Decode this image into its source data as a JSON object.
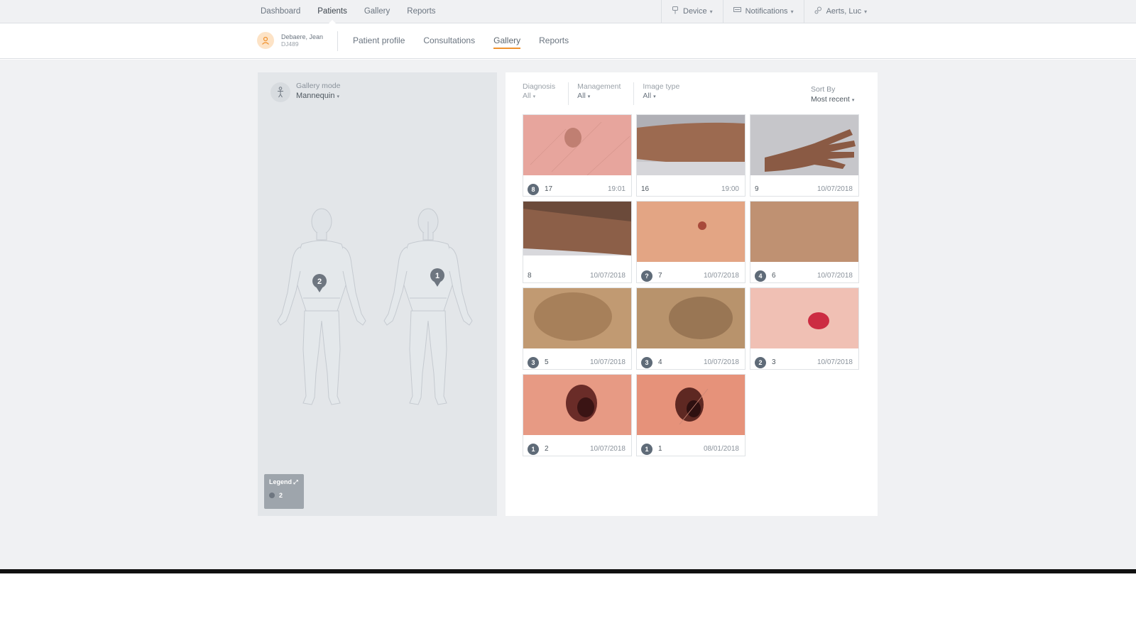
{
  "topnav": {
    "items": [
      {
        "label": "Dashboard",
        "active": false
      },
      {
        "label": "Patients",
        "active": true
      },
      {
        "label": "Gallery",
        "active": false
      },
      {
        "label": "Reports",
        "active": false
      }
    ],
    "device": {
      "label": "Device",
      "icon": "device-icon"
    },
    "notifications": {
      "label": "Notifications",
      "icon": "notifications-icon"
    },
    "user": {
      "label": "Aerts, Luc",
      "icon": "user-icon"
    }
  },
  "patient": {
    "name": "Debaere, Jean",
    "id": "DJ489",
    "icon": "patient-avatar-icon"
  },
  "subnav": {
    "tabs": [
      {
        "label": "Patient profile",
        "active": false
      },
      {
        "label": "Consultations",
        "active": false
      },
      {
        "label": "Gallery",
        "active": true
      },
      {
        "label": "Reports",
        "active": false
      }
    ]
  },
  "gallery_mode": {
    "label": "Gallery mode",
    "value": "Mannequin"
  },
  "mannequin": {
    "markers": [
      {
        "label": "2",
        "view": "front"
      },
      {
        "label": "1",
        "view": "back"
      }
    ]
  },
  "legend": {
    "title": "Legend",
    "count": "2"
  },
  "filters": {
    "diagnosis": {
      "label": "Diagnosis",
      "value": "All"
    },
    "management": {
      "label": "Management",
      "value": "All"
    },
    "image_type": {
      "label": "Image type",
      "value": "All"
    }
  },
  "sort": {
    "label": "Sort By",
    "value": "Most recent"
  },
  "images": [
    {
      "badge": "8",
      "number": "17",
      "date": "19:01",
      "kind": "dermoscopy-pink"
    },
    {
      "badge": "",
      "number": "16",
      "date": "19:00",
      "kind": "forearm"
    },
    {
      "badge": "",
      "number": "9",
      "date": "10/07/2018",
      "kind": "hand"
    },
    {
      "badge": "",
      "number": "8",
      "date": "10/07/2018",
      "kind": "forearm2"
    },
    {
      "badge": "?",
      "number": "7",
      "date": "10/07/2018",
      "kind": "skin-mole-small"
    },
    {
      "badge": "4",
      "number": "6",
      "date": "10/07/2018",
      "kind": "skin-tan"
    },
    {
      "badge": "3",
      "number": "5",
      "date": "10/07/2018",
      "kind": "dermoscopy-brown"
    },
    {
      "badge": "3",
      "number": "4",
      "date": "10/07/2018",
      "kind": "dermoscopy-brown2"
    },
    {
      "badge": "2",
      "number": "3",
      "date": "10/07/2018",
      "kind": "skin-red-lesion"
    },
    {
      "badge": "1",
      "number": "2",
      "date": "10/07/2018",
      "kind": "dermoscopy-dark"
    },
    {
      "badge": "1",
      "number": "1",
      "date": "08/01/2018",
      "kind": "dermoscopy-dark2"
    }
  ],
  "colors": {
    "accent": "#f0922e",
    "badge": "#5f6b78"
  }
}
